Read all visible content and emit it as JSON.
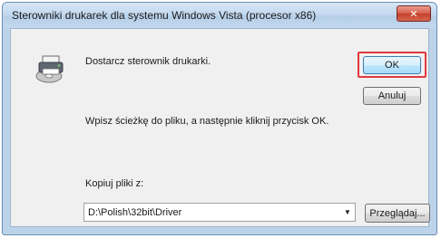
{
  "window": {
    "title": "Sterowniki drukarek dla systemu Windows Vista (procesor x86)",
    "close_glyph": "✕"
  },
  "dialog": {
    "icon": "printer-disc-icon",
    "message": "Dostarcz sterownik drukarki.",
    "instruction": "Wpisz ścieżkę do pliku, a następnie kliknij przycisk OK.",
    "copy_label": "Kopiuj pliki z:",
    "path_value": "D:\\Polish\\32bit\\Driver",
    "combo_arrow": "▼"
  },
  "buttons": {
    "ok_label": "OK",
    "cancel_label": "Anuluj",
    "browse_label": "Przeglądaj..."
  },
  "colors": {
    "highlight": "#e23a3a",
    "close_button": "#c33f2c"
  }
}
